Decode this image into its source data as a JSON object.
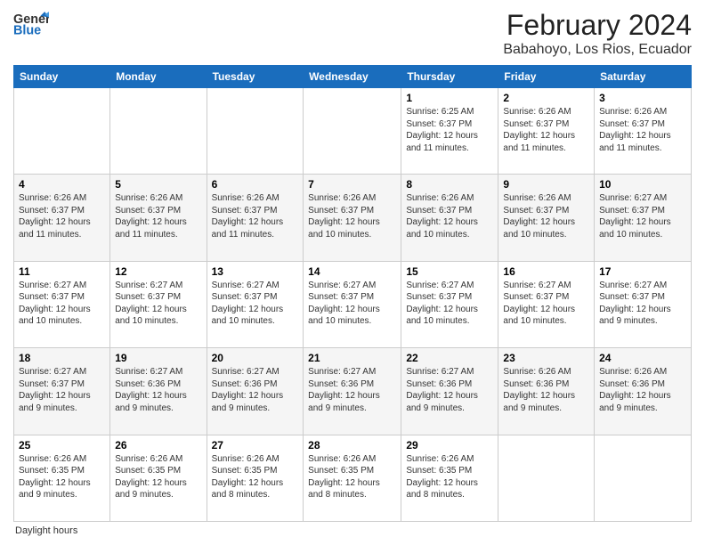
{
  "header": {
    "logo_line1": "General",
    "logo_line2": "Blue",
    "main_title": "February 2024",
    "sub_title": "Babahoyo, Los Rios, Ecuador"
  },
  "calendar": {
    "days_of_week": [
      "Sunday",
      "Monday",
      "Tuesday",
      "Wednesday",
      "Thursday",
      "Friday",
      "Saturday"
    ],
    "weeks": [
      [
        {
          "day": "",
          "info": ""
        },
        {
          "day": "",
          "info": ""
        },
        {
          "day": "",
          "info": ""
        },
        {
          "day": "",
          "info": ""
        },
        {
          "day": "1",
          "info": "Sunrise: 6:25 AM\nSunset: 6:37 PM\nDaylight: 12 hours and 11 minutes."
        },
        {
          "day": "2",
          "info": "Sunrise: 6:26 AM\nSunset: 6:37 PM\nDaylight: 12 hours and 11 minutes."
        },
        {
          "day": "3",
          "info": "Sunrise: 6:26 AM\nSunset: 6:37 PM\nDaylight: 12 hours and 11 minutes."
        }
      ],
      [
        {
          "day": "4",
          "info": "Sunrise: 6:26 AM\nSunset: 6:37 PM\nDaylight: 12 hours and 11 minutes."
        },
        {
          "day": "5",
          "info": "Sunrise: 6:26 AM\nSunset: 6:37 PM\nDaylight: 12 hours and 11 minutes."
        },
        {
          "day": "6",
          "info": "Sunrise: 6:26 AM\nSunset: 6:37 PM\nDaylight: 12 hours and 11 minutes."
        },
        {
          "day": "7",
          "info": "Sunrise: 6:26 AM\nSunset: 6:37 PM\nDaylight: 12 hours and 10 minutes."
        },
        {
          "day": "8",
          "info": "Sunrise: 6:26 AM\nSunset: 6:37 PM\nDaylight: 12 hours and 10 minutes."
        },
        {
          "day": "9",
          "info": "Sunrise: 6:26 AM\nSunset: 6:37 PM\nDaylight: 12 hours and 10 minutes."
        },
        {
          "day": "10",
          "info": "Sunrise: 6:27 AM\nSunset: 6:37 PM\nDaylight: 12 hours and 10 minutes."
        }
      ],
      [
        {
          "day": "11",
          "info": "Sunrise: 6:27 AM\nSunset: 6:37 PM\nDaylight: 12 hours and 10 minutes."
        },
        {
          "day": "12",
          "info": "Sunrise: 6:27 AM\nSunset: 6:37 PM\nDaylight: 12 hours and 10 minutes."
        },
        {
          "day": "13",
          "info": "Sunrise: 6:27 AM\nSunset: 6:37 PM\nDaylight: 12 hours and 10 minutes."
        },
        {
          "day": "14",
          "info": "Sunrise: 6:27 AM\nSunset: 6:37 PM\nDaylight: 12 hours and 10 minutes."
        },
        {
          "day": "15",
          "info": "Sunrise: 6:27 AM\nSunset: 6:37 PM\nDaylight: 12 hours and 10 minutes."
        },
        {
          "day": "16",
          "info": "Sunrise: 6:27 AM\nSunset: 6:37 PM\nDaylight: 12 hours and 10 minutes."
        },
        {
          "day": "17",
          "info": "Sunrise: 6:27 AM\nSunset: 6:37 PM\nDaylight: 12 hours and 9 minutes."
        }
      ],
      [
        {
          "day": "18",
          "info": "Sunrise: 6:27 AM\nSunset: 6:37 PM\nDaylight: 12 hours and 9 minutes."
        },
        {
          "day": "19",
          "info": "Sunrise: 6:27 AM\nSunset: 6:36 PM\nDaylight: 12 hours and 9 minutes."
        },
        {
          "day": "20",
          "info": "Sunrise: 6:27 AM\nSunset: 6:36 PM\nDaylight: 12 hours and 9 minutes."
        },
        {
          "day": "21",
          "info": "Sunrise: 6:27 AM\nSunset: 6:36 PM\nDaylight: 12 hours and 9 minutes."
        },
        {
          "day": "22",
          "info": "Sunrise: 6:27 AM\nSunset: 6:36 PM\nDaylight: 12 hours and 9 minutes."
        },
        {
          "day": "23",
          "info": "Sunrise: 6:26 AM\nSunset: 6:36 PM\nDaylight: 12 hours and 9 minutes."
        },
        {
          "day": "24",
          "info": "Sunrise: 6:26 AM\nSunset: 6:36 PM\nDaylight: 12 hours and 9 minutes."
        }
      ],
      [
        {
          "day": "25",
          "info": "Sunrise: 6:26 AM\nSunset: 6:35 PM\nDaylight: 12 hours and 9 minutes."
        },
        {
          "day": "26",
          "info": "Sunrise: 6:26 AM\nSunset: 6:35 PM\nDaylight: 12 hours and 9 minutes."
        },
        {
          "day": "27",
          "info": "Sunrise: 6:26 AM\nSunset: 6:35 PM\nDaylight: 12 hours and 8 minutes."
        },
        {
          "day": "28",
          "info": "Sunrise: 6:26 AM\nSunset: 6:35 PM\nDaylight: 12 hours and 8 minutes."
        },
        {
          "day": "29",
          "info": "Sunrise: 6:26 AM\nSunset: 6:35 PM\nDaylight: 12 hours and 8 minutes."
        },
        {
          "day": "",
          "info": ""
        },
        {
          "day": "",
          "info": ""
        }
      ]
    ]
  },
  "footer": {
    "note": "Daylight hours"
  }
}
